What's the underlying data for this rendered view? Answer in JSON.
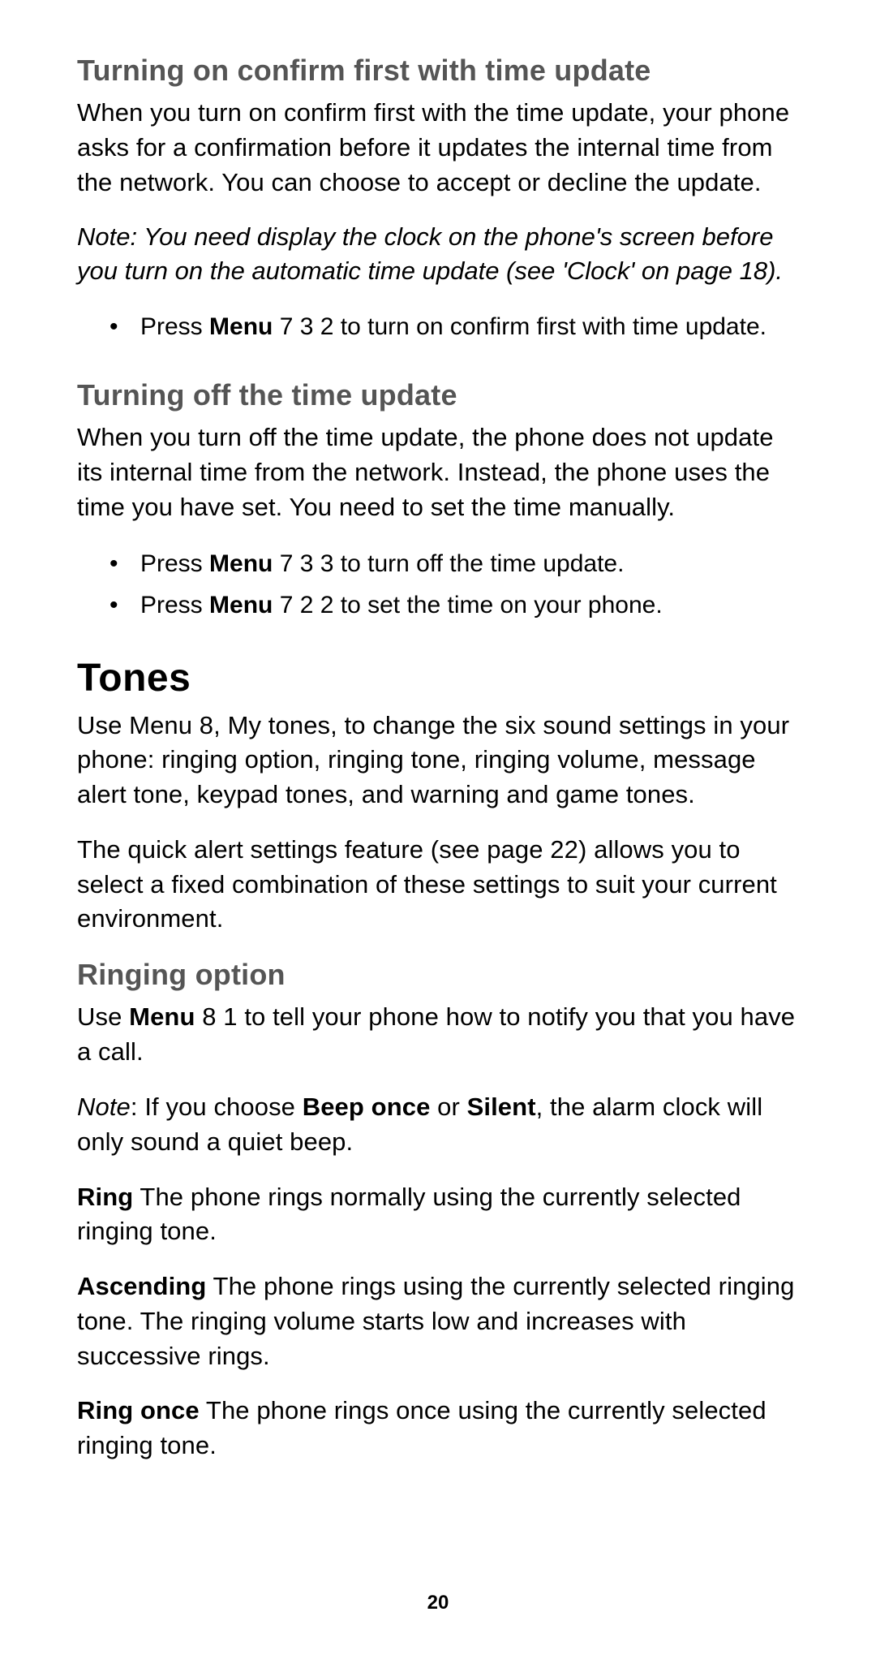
{
  "page_number": "20",
  "s1": {
    "heading": "Turning on confirm first with time update",
    "para1": "When you turn on confirm first with the time update, your phone asks for a confirmation before it updates the internal time from the network. You can choose to accept or decline the update.",
    "note": "Note: You need display the clock on the phone's screen before you turn on the automatic time update  (see 'Clock' on page 18).",
    "bullet1_pre": "Press ",
    "bullet1_bold": "Menu",
    "bullet1_post": " 7 3 2 to turn on confirm first with time update."
  },
  "s2": {
    "heading": "Turning off the time update",
    "para1": "When you turn off the time update, the phone does not update its internal time from the network. Instead, the phone uses the time you have set. You need to set the time manually.",
    "bullet1_pre": "Press ",
    "bullet1_bold": "Menu",
    "bullet1_post": " 7 3 3  to turn off the time update.",
    "bullet2_pre": "Press ",
    "bullet2_bold": "Menu",
    "bullet2_post": " 7 2 2  to set the time on your phone."
  },
  "s3": {
    "heading": "Tones",
    "para1": "Use Menu 8, My tones, to change the six sound settings in your phone: ringing option, ringing tone, ringing volume, message alert tone, keypad tones, and warning and game tones.",
    "para2": "The quick alert settings feature (see page 22) allows you to select a fixed combination of these settings to suit your current environment."
  },
  "s4": {
    "heading": "Ringing option",
    "p1_a": "Use ",
    "p1_b": "Menu",
    "p1_c": " 8 1 to tell your phone how to notify you that you have a call.",
    "p2_a": "Note",
    "p2_b": ":  If you choose ",
    "p2_c": "Beep once",
    "p2_d": " or ",
    "p2_e": "Silent",
    "p2_f": ", the alarm clock will only sound a quiet beep.",
    "p3_a": "Ring",
    "p3_b": "  The phone rings normally using the currently selected ringing tone.",
    "p4_a": "Ascending",
    "p4_b": "  The phone rings using the currently selected ringing tone. The ringing volume starts low and increases with successive rings.",
    "p5_a": "Ring once",
    "p5_b": "  The phone rings once using the currently selected ringing tone."
  }
}
